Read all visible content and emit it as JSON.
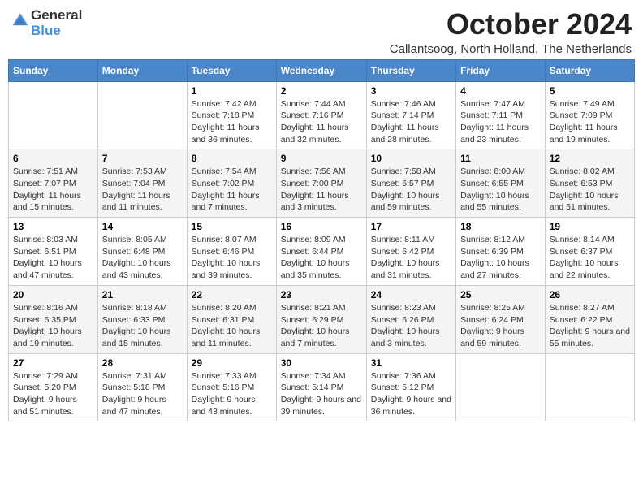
{
  "logo": {
    "text_general": "General",
    "text_blue": "Blue"
  },
  "title": {
    "month": "October 2024",
    "location": "Callantsoog, North Holland, The Netherlands"
  },
  "weekdays": [
    "Sunday",
    "Monday",
    "Tuesday",
    "Wednesday",
    "Thursday",
    "Friday",
    "Saturday"
  ],
  "weeks": [
    [
      {
        "day": "",
        "sunrise": "",
        "sunset": "",
        "daylight": ""
      },
      {
        "day": "",
        "sunrise": "",
        "sunset": "",
        "daylight": ""
      },
      {
        "day": "1",
        "sunrise": "Sunrise: 7:42 AM",
        "sunset": "Sunset: 7:18 PM",
        "daylight": "Daylight: 11 hours and 36 minutes."
      },
      {
        "day": "2",
        "sunrise": "Sunrise: 7:44 AM",
        "sunset": "Sunset: 7:16 PM",
        "daylight": "Daylight: 11 hours and 32 minutes."
      },
      {
        "day": "3",
        "sunrise": "Sunrise: 7:46 AM",
        "sunset": "Sunset: 7:14 PM",
        "daylight": "Daylight: 11 hours and 28 minutes."
      },
      {
        "day": "4",
        "sunrise": "Sunrise: 7:47 AM",
        "sunset": "Sunset: 7:11 PM",
        "daylight": "Daylight: 11 hours and 23 minutes."
      },
      {
        "day": "5",
        "sunrise": "Sunrise: 7:49 AM",
        "sunset": "Sunset: 7:09 PM",
        "daylight": "Daylight: 11 hours and 19 minutes."
      }
    ],
    [
      {
        "day": "6",
        "sunrise": "Sunrise: 7:51 AM",
        "sunset": "Sunset: 7:07 PM",
        "daylight": "Daylight: 11 hours and 15 minutes."
      },
      {
        "day": "7",
        "sunrise": "Sunrise: 7:53 AM",
        "sunset": "Sunset: 7:04 PM",
        "daylight": "Daylight: 11 hours and 11 minutes."
      },
      {
        "day": "8",
        "sunrise": "Sunrise: 7:54 AM",
        "sunset": "Sunset: 7:02 PM",
        "daylight": "Daylight: 11 hours and 7 minutes."
      },
      {
        "day": "9",
        "sunrise": "Sunrise: 7:56 AM",
        "sunset": "Sunset: 7:00 PM",
        "daylight": "Daylight: 11 hours and 3 minutes."
      },
      {
        "day": "10",
        "sunrise": "Sunrise: 7:58 AM",
        "sunset": "Sunset: 6:57 PM",
        "daylight": "Daylight: 10 hours and 59 minutes."
      },
      {
        "day": "11",
        "sunrise": "Sunrise: 8:00 AM",
        "sunset": "Sunset: 6:55 PM",
        "daylight": "Daylight: 10 hours and 55 minutes."
      },
      {
        "day": "12",
        "sunrise": "Sunrise: 8:02 AM",
        "sunset": "Sunset: 6:53 PM",
        "daylight": "Daylight: 10 hours and 51 minutes."
      }
    ],
    [
      {
        "day": "13",
        "sunrise": "Sunrise: 8:03 AM",
        "sunset": "Sunset: 6:51 PM",
        "daylight": "Daylight: 10 hours and 47 minutes."
      },
      {
        "day": "14",
        "sunrise": "Sunrise: 8:05 AM",
        "sunset": "Sunset: 6:48 PM",
        "daylight": "Daylight: 10 hours and 43 minutes."
      },
      {
        "day": "15",
        "sunrise": "Sunrise: 8:07 AM",
        "sunset": "Sunset: 6:46 PM",
        "daylight": "Daylight: 10 hours and 39 minutes."
      },
      {
        "day": "16",
        "sunrise": "Sunrise: 8:09 AM",
        "sunset": "Sunset: 6:44 PM",
        "daylight": "Daylight: 10 hours and 35 minutes."
      },
      {
        "day": "17",
        "sunrise": "Sunrise: 8:11 AM",
        "sunset": "Sunset: 6:42 PM",
        "daylight": "Daylight: 10 hours and 31 minutes."
      },
      {
        "day": "18",
        "sunrise": "Sunrise: 8:12 AM",
        "sunset": "Sunset: 6:39 PM",
        "daylight": "Daylight: 10 hours and 27 minutes."
      },
      {
        "day": "19",
        "sunrise": "Sunrise: 8:14 AM",
        "sunset": "Sunset: 6:37 PM",
        "daylight": "Daylight: 10 hours and 22 minutes."
      }
    ],
    [
      {
        "day": "20",
        "sunrise": "Sunrise: 8:16 AM",
        "sunset": "Sunset: 6:35 PM",
        "daylight": "Daylight: 10 hours and 19 minutes."
      },
      {
        "day": "21",
        "sunrise": "Sunrise: 8:18 AM",
        "sunset": "Sunset: 6:33 PM",
        "daylight": "Daylight: 10 hours and 15 minutes."
      },
      {
        "day": "22",
        "sunrise": "Sunrise: 8:20 AM",
        "sunset": "Sunset: 6:31 PM",
        "daylight": "Daylight: 10 hours and 11 minutes."
      },
      {
        "day": "23",
        "sunrise": "Sunrise: 8:21 AM",
        "sunset": "Sunset: 6:29 PM",
        "daylight": "Daylight: 10 hours and 7 minutes."
      },
      {
        "day": "24",
        "sunrise": "Sunrise: 8:23 AM",
        "sunset": "Sunset: 6:26 PM",
        "daylight": "Daylight: 10 hours and 3 minutes."
      },
      {
        "day": "25",
        "sunrise": "Sunrise: 8:25 AM",
        "sunset": "Sunset: 6:24 PM",
        "daylight": "Daylight: 9 hours and 59 minutes."
      },
      {
        "day": "26",
        "sunrise": "Sunrise: 8:27 AM",
        "sunset": "Sunset: 6:22 PM",
        "daylight": "Daylight: 9 hours and 55 minutes."
      }
    ],
    [
      {
        "day": "27",
        "sunrise": "Sunrise: 7:29 AM",
        "sunset": "Sunset: 5:20 PM",
        "daylight": "Daylight: 9 hours and 51 minutes."
      },
      {
        "day": "28",
        "sunrise": "Sunrise: 7:31 AM",
        "sunset": "Sunset: 5:18 PM",
        "daylight": "Daylight: 9 hours and 47 minutes."
      },
      {
        "day": "29",
        "sunrise": "Sunrise: 7:33 AM",
        "sunset": "Sunset: 5:16 PM",
        "daylight": "Daylight: 9 hours and 43 minutes."
      },
      {
        "day": "30",
        "sunrise": "Sunrise: 7:34 AM",
        "sunset": "Sunset: 5:14 PM",
        "daylight": "Daylight: 9 hours and 39 minutes."
      },
      {
        "day": "31",
        "sunrise": "Sunrise: 7:36 AM",
        "sunset": "Sunset: 5:12 PM",
        "daylight": "Daylight: 9 hours and 36 minutes."
      },
      {
        "day": "",
        "sunrise": "",
        "sunset": "",
        "daylight": ""
      },
      {
        "day": "",
        "sunrise": "",
        "sunset": "",
        "daylight": ""
      }
    ]
  ]
}
